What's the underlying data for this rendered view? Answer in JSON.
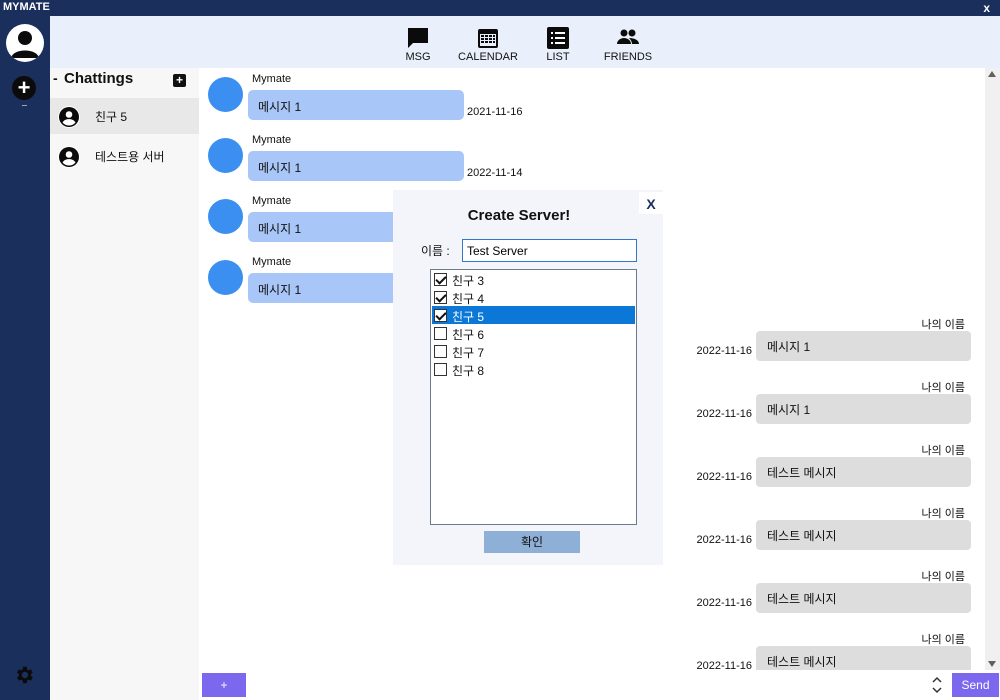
{
  "window": {
    "title": "MYMATE",
    "close": "x"
  },
  "nav": {
    "items": [
      {
        "label": "MSG",
        "icon": "chat-icon"
      },
      {
        "label": "CALENDAR",
        "icon": "calendar-icon"
      },
      {
        "label": "LIST",
        "icon": "list-icon"
      },
      {
        "label": "FRIENDS",
        "icon": "friends-icon"
      }
    ]
  },
  "sidebar": {
    "add": "+"
  },
  "chatlist": {
    "title": "Chattings",
    "dash": "-",
    "add": "+",
    "rooms": [
      {
        "name": "친구 5",
        "selected": true
      },
      {
        "name": "테스트용 서버",
        "selected": false
      }
    ]
  },
  "messages": {
    "incoming": [
      {
        "sender": "Mymate",
        "text": "메시지 1",
        "date": "2021-11-16"
      },
      {
        "sender": "Mymate",
        "text": "메시지 1",
        "date": "2022-11-14"
      },
      {
        "sender": "Mymate",
        "text": "메시지 1",
        "date": ""
      },
      {
        "sender": "Mymate",
        "text": "메시지 1",
        "date": ""
      }
    ],
    "outgoing": [
      {
        "sender": "나의 이름",
        "text": "메시지 1",
        "date": "2022-11-16"
      },
      {
        "sender": "나의 이름",
        "text": "메시지 1",
        "date": "2022-11-16"
      },
      {
        "sender": "나의 이름",
        "text": "테스트 메시지",
        "date": "2022-11-16"
      },
      {
        "sender": "나의 이름",
        "text": "테스트 메시지",
        "date": "2022-11-16"
      },
      {
        "sender": "나의 이름",
        "text": "테스트 메시지",
        "date": "2022-11-16"
      },
      {
        "sender": "나의 이름",
        "text": "테스트 메시지",
        "date": "2022-11-16"
      }
    ]
  },
  "bottom": {
    "attach": "+",
    "send": "Send"
  },
  "dialog": {
    "title": "Create Server!",
    "close": "X",
    "name_label": "이름 :",
    "name_value": "Test Server",
    "confirm": "확인",
    "friends": [
      {
        "name": "친구 3",
        "checked": true,
        "selected": false
      },
      {
        "name": "친구 4",
        "checked": true,
        "selected": false
      },
      {
        "name": "친구 5",
        "checked": true,
        "selected": true
      },
      {
        "name": "친구 6",
        "checked": false,
        "selected": false
      },
      {
        "name": "친구 7",
        "checked": false,
        "selected": false
      },
      {
        "name": "친구 8",
        "checked": false,
        "selected": false
      }
    ]
  },
  "colors": {
    "sidebar": "#1a2f5c",
    "topnav": "#eaf0fb",
    "accent": "#7b68ee",
    "bubble_in": "#a9c6f8",
    "bubble_out": "#dddddd",
    "selection": "#0b78d7"
  }
}
